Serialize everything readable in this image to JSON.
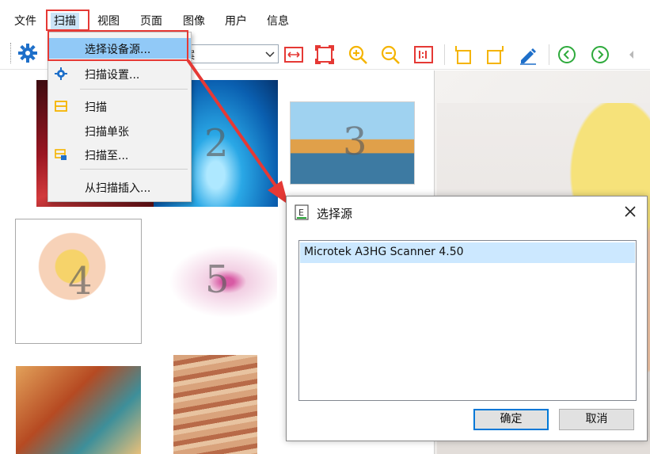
{
  "menubar": {
    "items": [
      "文件",
      "扫描",
      "视图",
      "页面",
      "图像",
      "用户",
      "信息"
    ]
  },
  "toolbar": {
    "combo_value": "案"
  },
  "thumbnails": {
    "numbers": [
      "2",
      "3",
      "4",
      "5"
    ]
  },
  "scan_menu": {
    "items": [
      "选择设备源...",
      "扫描设置...",
      "扫描",
      "扫描单张",
      "扫描至...",
      "从扫描插入..."
    ]
  },
  "dialog": {
    "title": "选择源",
    "icon_letter": "E",
    "sources": [
      "Microtek A3HG Scanner 4.50"
    ],
    "ok_label": "确定",
    "cancel_label": "取消"
  },
  "colors": {
    "highlight_red": "#e53935",
    "menu_hover": "#91c9f7",
    "selection": "#cce8ff",
    "accent_blue": "#0078d7",
    "toolbar_red": "#e53935",
    "toolbar_yellow": "#f5b400",
    "toolbar_green": "#2eaa3c",
    "toolbar_blue": "#1e6fc9"
  }
}
